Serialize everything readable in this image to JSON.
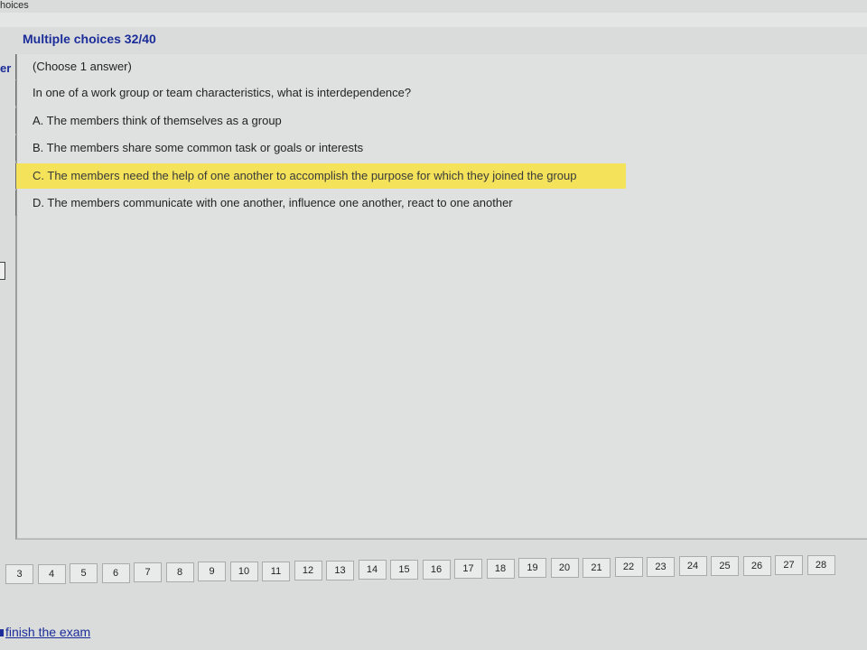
{
  "window": {
    "title": "hoices"
  },
  "panel": {
    "title": "Multiple choices 32/40",
    "side_label": "er"
  },
  "question": {
    "instruction": "(Choose 1 answer)",
    "text": "In one of a work group or team characteristics, what is interdependence?",
    "options": [
      {
        "label": "A. The members think of themselves as a group"
      },
      {
        "label": "B. The members share some common task or goals or interests"
      },
      {
        "label": "C. The members need the help of one another to accomplish the purpose for which they joined the group",
        "highlighted": true
      },
      {
        "label": "D. The members communicate with one another, influence one another, react to one another"
      }
    ]
  },
  "navigator": {
    "numbers": [
      "3",
      "4",
      "5",
      "6",
      "7",
      "8",
      "9",
      "10",
      "11",
      "12",
      "13",
      "14",
      "15",
      "16",
      "17",
      "18",
      "19",
      "20",
      "21",
      "22",
      "23",
      "24",
      "25",
      "26",
      "27",
      "28"
    ]
  },
  "footer": {
    "finish_label": "finish the exam"
  },
  "colors": {
    "accent": "#1c2d9a",
    "highlight": "#f3e25a",
    "background": "#d9dcdb"
  }
}
